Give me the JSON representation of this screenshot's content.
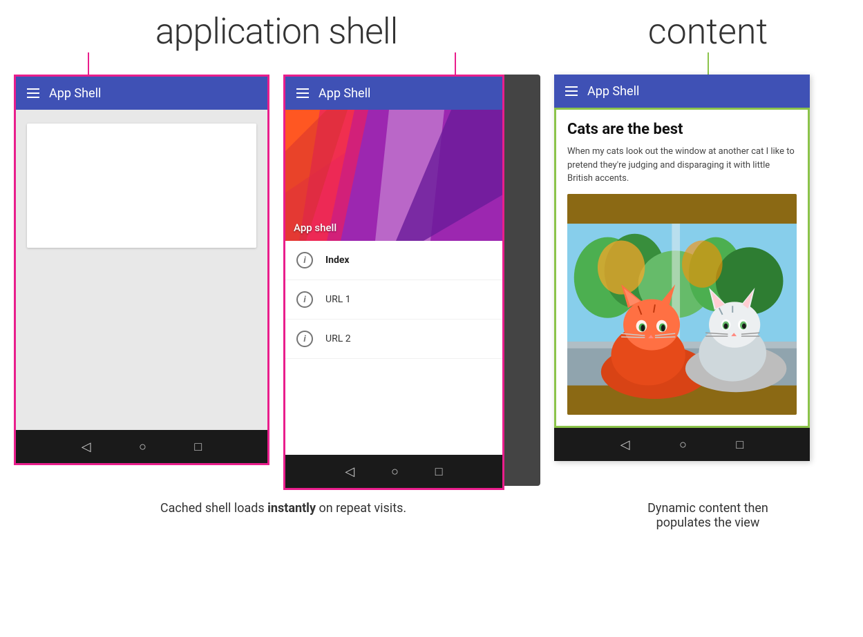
{
  "titles": {
    "application_shell": "application shell",
    "content": "content"
  },
  "phone1": {
    "app_bar_title": "App Shell",
    "app_bar_icon": "hamburger"
  },
  "phone2": {
    "app_bar_title": "App Shell",
    "drawer_label": "App shell",
    "menu_items": [
      {
        "label": "Index",
        "bold": true
      },
      {
        "label": "URL 1",
        "bold": false
      },
      {
        "label": "URL 2",
        "bold": false
      }
    ]
  },
  "phone3": {
    "app_bar_title": "App Shell",
    "content_title": "Cats are the best",
    "content_text": "When my cats look out the window at another cat I like to pretend they're judging and disparaging it with little British accents."
  },
  "captions": {
    "left": "Cached shell loads ",
    "left_bold": "instantly",
    "left_end": " on repeat visits.",
    "right_line1": "Dynamic content then",
    "right_line2": "populates the view"
  },
  "nav": {
    "back": "◁",
    "home": "○",
    "recent": "□"
  },
  "colors": {
    "pink": "#E91E8C",
    "green": "#8BC34A",
    "blue": "#3F51B5",
    "dark": "#1a1a1a"
  }
}
